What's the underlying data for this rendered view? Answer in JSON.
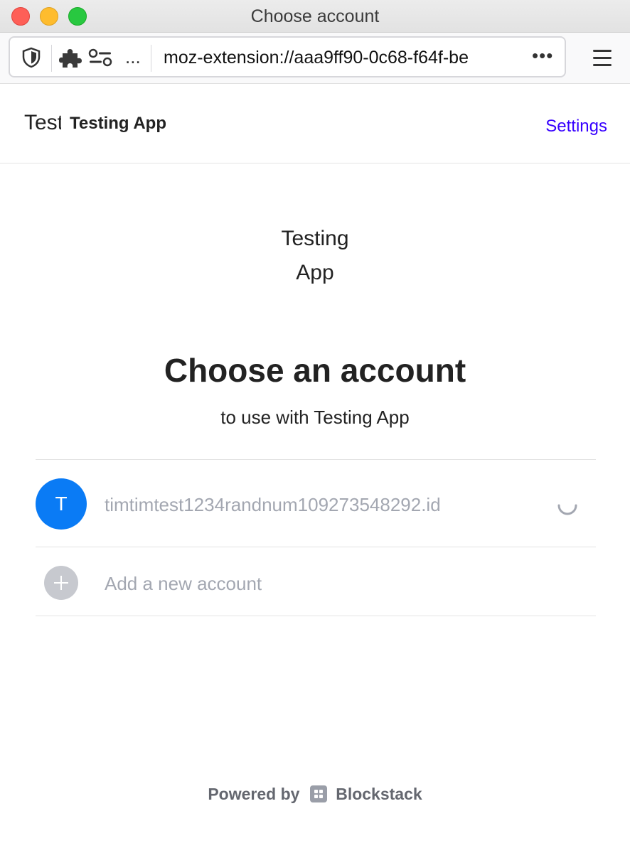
{
  "window": {
    "title": "Choose account"
  },
  "toolbar": {
    "url": "moz-extension://aaa9ff90-0c68-f64f-be",
    "overflow_dots": "...",
    "more_dots": "•••"
  },
  "app_header": {
    "logo_text": "Testing App",
    "app_name": "Testing App",
    "settings_label": "Settings"
  },
  "main": {
    "app_icon_lines": [
      "Testing",
      "App"
    ],
    "heading": "Choose an account",
    "subheading": "to use with Testing App",
    "accounts": [
      {
        "avatar_letter": "T",
        "name": "timtimtest1234randnum109273548292.id",
        "loading": true
      }
    ],
    "add_account_label": "Add a new account"
  },
  "footer": {
    "powered_by": "Powered by",
    "brand": "Blockstack"
  },
  "colors": {
    "accent_link": "#3700ff",
    "avatar": "#0a7bf5",
    "muted_text": "#a3a7b1"
  }
}
